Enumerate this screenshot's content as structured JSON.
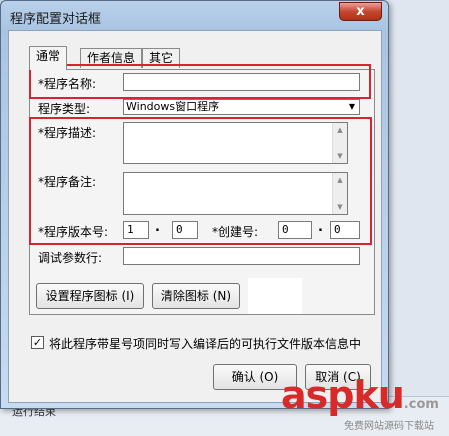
{
  "dialog": {
    "title": "程序配置对话框",
    "close_label": "x"
  },
  "tabs": [
    "通常",
    "作者信息",
    "其它"
  ],
  "form": {
    "name_label": "*程序名称:",
    "name_value": "",
    "type_label": "程序类型:",
    "type_value": "Windows窗口程序",
    "description_label": "*程序描述:",
    "remark_label": "*程序备注:",
    "version_label": "*程序版本号:",
    "version_major": "1",
    "version_minor": "0",
    "build_label": "*创建号:",
    "build_major": "0",
    "build_minor": "0",
    "debug_params_label": "调试参数行:",
    "debug_params_value": ""
  },
  "buttons": {
    "set_icon": "设置程序图标 (I)",
    "clear_icon": "清除图标 (N)",
    "ok": "确认 (O)",
    "cancel": "取消 (C)"
  },
  "checkbox": {
    "label": "将此程序带星号项同时写入编译后的可执行文件版本信息中",
    "checked": true,
    "mark": "✓"
  },
  "watermark": {
    "main": "aspku",
    "suffix": ".com",
    "sub": "免费网站源码下载站"
  },
  "background": {
    "status_text": "运行结束"
  },
  "colors": {
    "highlight_box": "#d8242e",
    "title_bar": "#b9d1ea",
    "close_button": "#c4472e"
  }
}
